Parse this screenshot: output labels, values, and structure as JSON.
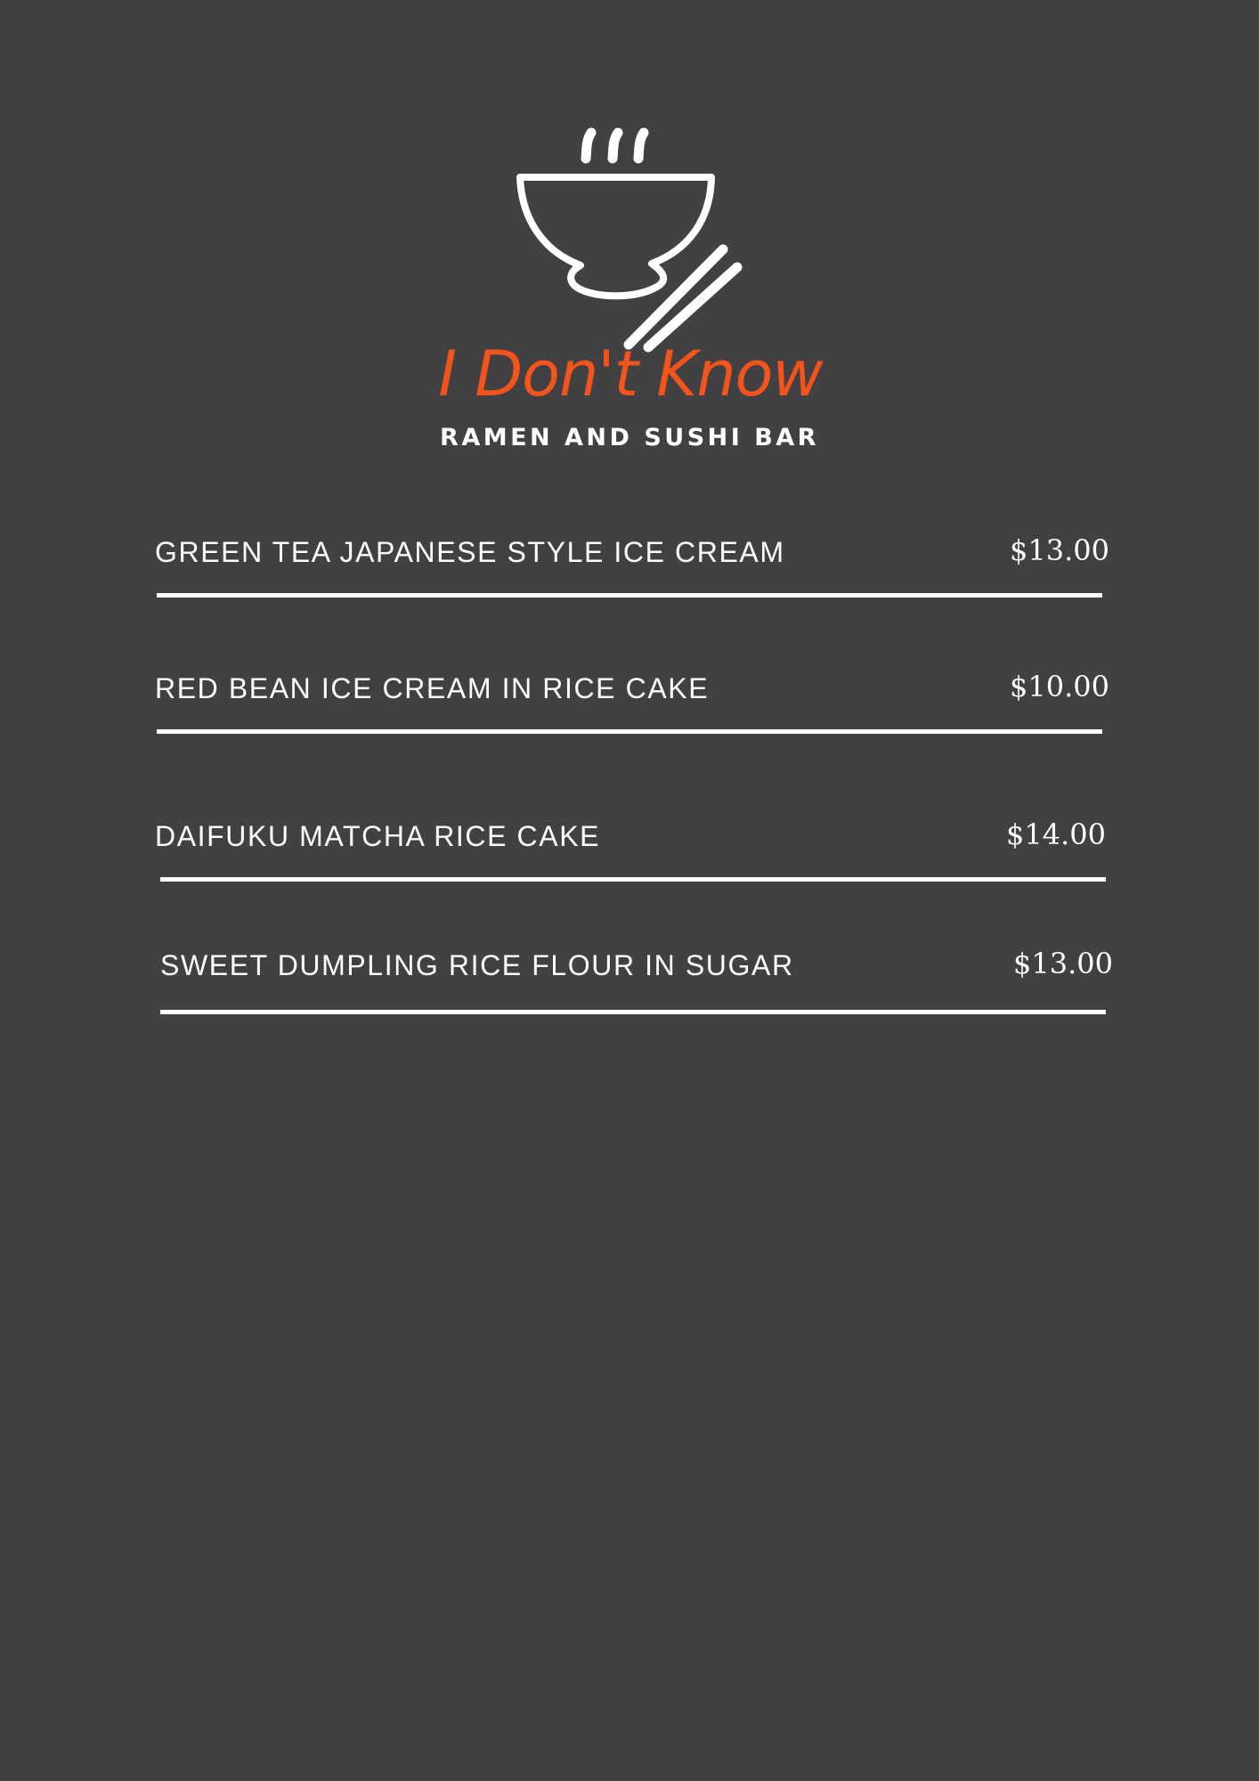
{
  "brand": {
    "name": "I Don't Know",
    "tagline": "RAMEN AND SUSHI BAR",
    "name_color": "#f2541b",
    "icon": "ramen-bowl-chopsticks-icon"
  },
  "menu": {
    "items": [
      {
        "name": "GREEN TEA JAPANESE STYLE ICE CREAM",
        "price": "$13.00"
      },
      {
        "name": "RED BEAN ICE CREAM IN RICE CAKE",
        "price": "$10.00"
      },
      {
        "name": "DAIFUKU MATCHA RICE CAKE",
        "price": "$14.00"
      },
      {
        "name": "SWEET DUMPLING RICE FLOUR IN SUGAR",
        "price": "$13.00"
      }
    ]
  },
  "colors": {
    "background": "#414042",
    "text": "#ffffff",
    "accent": "#f2541b"
  }
}
